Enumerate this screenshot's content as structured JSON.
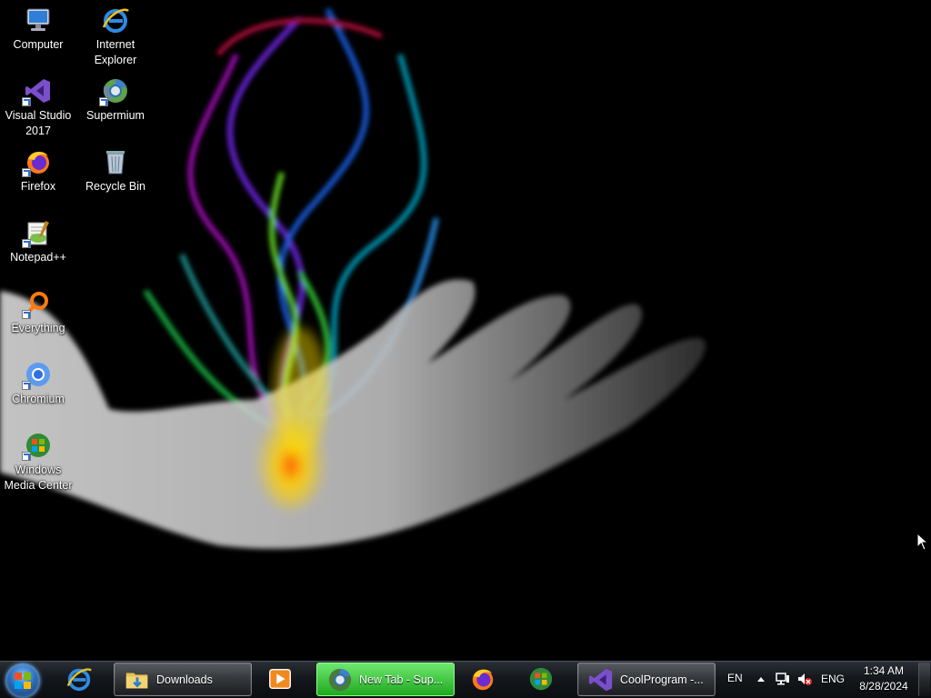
{
  "desktop": {
    "icons": [
      {
        "label": "Computer",
        "icon": "computer-icon"
      },
      {
        "label": "Internet Explorer",
        "icon": "internet-explorer-icon"
      },
      {
        "label": "Visual Studio 2017",
        "icon": "visual-studio-icon"
      },
      {
        "label": "Supermium",
        "icon": "supermium-icon"
      },
      {
        "label": "Firefox",
        "icon": "firefox-icon"
      },
      {
        "label": "Recycle Bin",
        "icon": "recycle-bin-icon"
      },
      {
        "label": "Notepad++",
        "icon": "notepad-plus-plus-icon"
      },
      {
        "label": "Everything",
        "icon": "everything-icon"
      },
      {
        "label": "Chromium",
        "icon": "chromium-icon"
      },
      {
        "label": "Windows Media Center",
        "icon": "windows-media-center-icon"
      }
    ]
  },
  "taskbar": {
    "start_icon": "windows-start-orb-icon",
    "items": [
      {
        "type": "pinned",
        "icon": "internet-explorer-icon",
        "label": ""
      },
      {
        "type": "window",
        "icon": "folder-downloads-icon",
        "label": "Downloads"
      },
      {
        "type": "pinned",
        "icon": "media-player-icon",
        "label": ""
      },
      {
        "type": "window-active",
        "icon": "supermium-icon",
        "label": "New Tab - Sup..."
      },
      {
        "type": "pinned",
        "icon": "firefox-icon",
        "label": ""
      },
      {
        "type": "pinned",
        "icon": "windows-media-center-icon",
        "label": ""
      },
      {
        "type": "window",
        "icon": "visual-studio-icon",
        "label": "CoolProgram -..."
      }
    ],
    "tray": {
      "language_short": "EN",
      "language_long": "ENG",
      "time": "1:34 AM",
      "date": "8/28/2024",
      "icons": [
        "show-hidden-icons-chevron-icon",
        "network-icon",
        "volume-muted-icon"
      ]
    }
  },
  "colors": {
    "desktop_background": "#000000",
    "taskbar_active_green": "#3ccc3c",
    "text": "#ffffff"
  }
}
